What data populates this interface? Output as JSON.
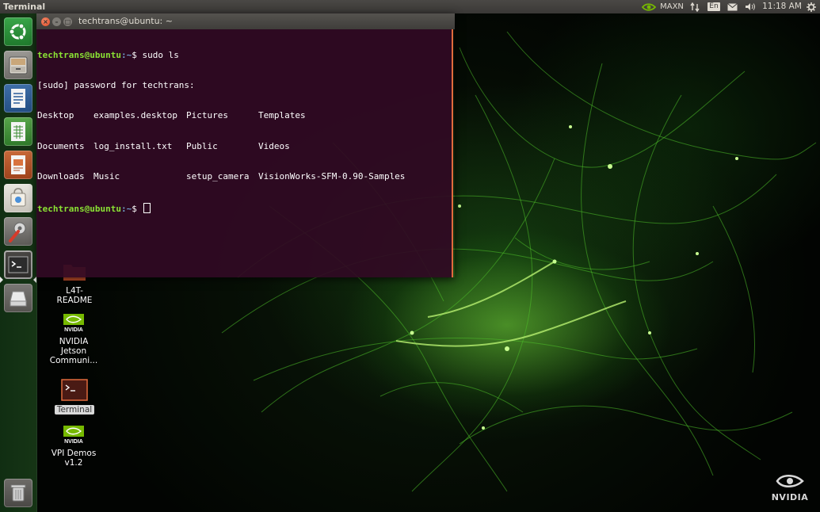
{
  "top_panel": {
    "app_title": "Terminal",
    "network_label": "MAXN",
    "keyboard_layout": "En",
    "clock": "11:18 AM"
  },
  "launcher": {
    "items": [
      {
        "name": "Ubuntu Dash",
        "icon": "ubuntu-logo-icon"
      },
      {
        "name": "Files",
        "icon": "file-cabinet-icon"
      },
      {
        "name": "LibreOffice Writer",
        "icon": "writer-document-icon"
      },
      {
        "name": "LibreOffice Calc",
        "icon": "calc-spreadsheet-icon"
      },
      {
        "name": "LibreOffice Impress",
        "icon": "impress-presentation-icon"
      },
      {
        "name": "Ubuntu Software",
        "icon": "shopping-bag-icon"
      },
      {
        "name": "System Settings",
        "icon": "settings-tools-icon"
      },
      {
        "name": "Terminal",
        "icon": "terminal-icon"
      },
      {
        "name": "Drive",
        "icon": "drive-icon"
      },
      {
        "name": "Trash",
        "icon": "trash-icon"
      }
    ]
  },
  "desktop_icons": [
    {
      "lines": [
        "L4T-",
        "README"
      ],
      "icon": "folder-icon"
    },
    {
      "lines": [
        "NVIDIA",
        "Jetson",
        "Communi..."
      ],
      "icon": "nvidia-logo-icon"
    },
    {
      "lines": [
        "Terminal"
      ],
      "icon": "terminal-icon",
      "selected": true
    },
    {
      "lines": [
        "VPI Demos",
        "v1.2"
      ],
      "icon": "nvidia-logo-icon"
    }
  ],
  "terminal": {
    "title": "techtrans@ubuntu: ~",
    "prompt_user": "techtrans@ubuntu",
    "prompt_path": ":~",
    "prompt_symbol": "$ ",
    "command": "sudo ls",
    "sudo_prompt": "[sudo] password for techtrans:",
    "ls_rows": [
      [
        "Desktop",
        "examples.desktop",
        "Pictures",
        "Templates"
      ],
      [
        "Documents",
        "log_install.txt",
        "Public",
        "Videos"
      ],
      [
        "Downloads",
        "Music",
        "setup_camera",
        "VisionWorks-SFM-0.90-Samples"
      ]
    ]
  },
  "wallpaper": {
    "brand": "NVIDIA",
    "accent_color": "#76b900"
  },
  "colors": {
    "terminal_bg": "#300a24",
    "prompt_user": "#8ae234",
    "prompt_path": "#729fcf",
    "close_button": "#df4a25",
    "launcher_bg": "#12321a"
  }
}
